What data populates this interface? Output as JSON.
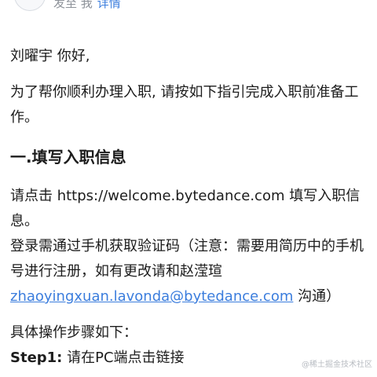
{
  "header": {
    "meta_prefix": "发至 我",
    "details_link": "详情"
  },
  "email": {
    "greeting": "刘曜宇 你好,",
    "intro": "为了帮你顺利办理入职, 请按如下指引完成入职前准备工作。",
    "section_title": "一.填写入职信息",
    "url_line": "请点击 https://welcome.bytedance.com 填写入职信息。",
    "login_line": "登录需通过手机获取验证码（注意：需要用简历中的手机号进行注册，如有更改请和赵滢瑄",
    "contact_email": "zhaoyingxuan.lavonda@bytedance.com",
    "contact_suffix": " 沟通）",
    "steps_intro": "具体操作步骤如下：",
    "step1_label": "Step1:",
    "step1_text": " 请在PC端点击链接"
  },
  "watermark": "@稀土掘金技术社区"
}
